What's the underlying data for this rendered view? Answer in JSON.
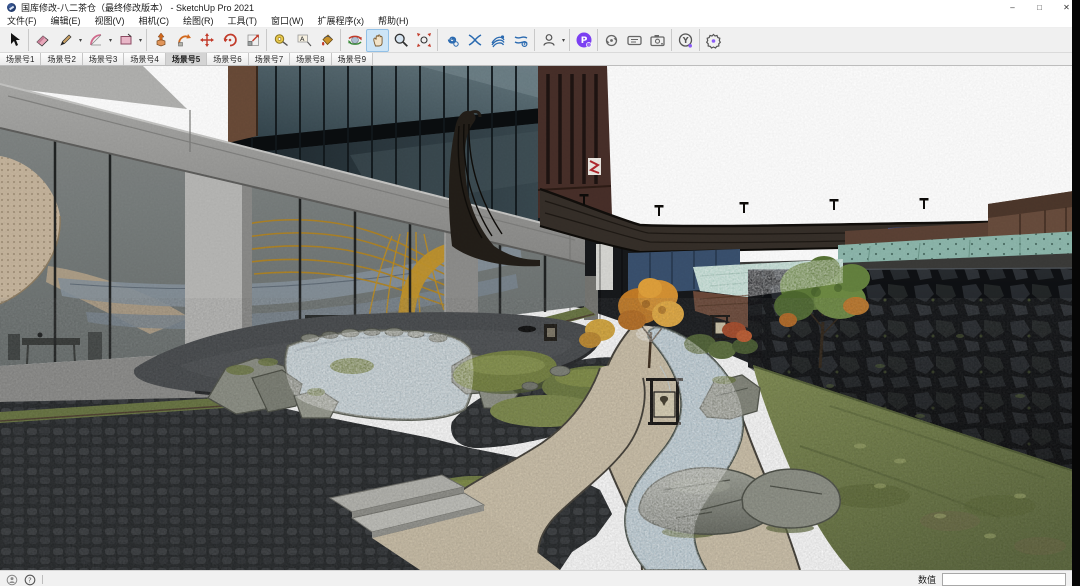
{
  "window": {
    "title": "国库修改-八二茶仓（最终修改版本） - SketchUp Pro 2021",
    "controls": {
      "minimize": "–",
      "maximize": "□",
      "close": "✕"
    }
  },
  "menubar": {
    "items": [
      "文件(F)",
      "编辑(E)",
      "视图(V)",
      "相机(C)",
      "绘图(R)",
      "工具(T)",
      "窗口(W)",
      "扩展程序(x)",
      "帮助(H)"
    ]
  },
  "toolbar": {
    "tools": [
      "select",
      "eraser",
      "line",
      "arc",
      "shape",
      "push-pull",
      "follow-me",
      "move",
      "rotate",
      "scale",
      "tape-measure",
      "text",
      "paint-bucket",
      "orbit",
      "pan",
      "zoom",
      "zoom-extents",
      "curve-plugin-1",
      "curve-plugin-2",
      "curve-plugin-3",
      "curve-plugin-4",
      "account",
      "plugin-p",
      "sync",
      "panel",
      "camera",
      "y-badge",
      "gear-flower"
    ],
    "active_tool": "pan",
    "plugin_p_label": "P",
    "y_badge_label": "Y",
    "text_tool_letter": "A"
  },
  "scene_tabs": {
    "items": [
      "场景号1",
      "场景号2",
      "场景号3",
      "场景号4",
      "场景号5",
      "场景号6",
      "场景号7",
      "场景号8",
      "场景号9"
    ],
    "active_index": 4
  },
  "statusbar": {
    "measurements_label": "数值",
    "measurements_value": "",
    "help_glyph": "?"
  },
  "colors": {
    "titlebar_bg": "#FFFFFF",
    "toolbar_bg": "#F0F0F0",
    "active_tool_bg": "#CDE5F7",
    "active_tool_border": "#92C0E6",
    "sky": "#FFFFFF",
    "water": "#B4C4CB",
    "moss": "#75823F",
    "gravel": "#CFC3AB",
    "stone_wall": "#15171A"
  }
}
